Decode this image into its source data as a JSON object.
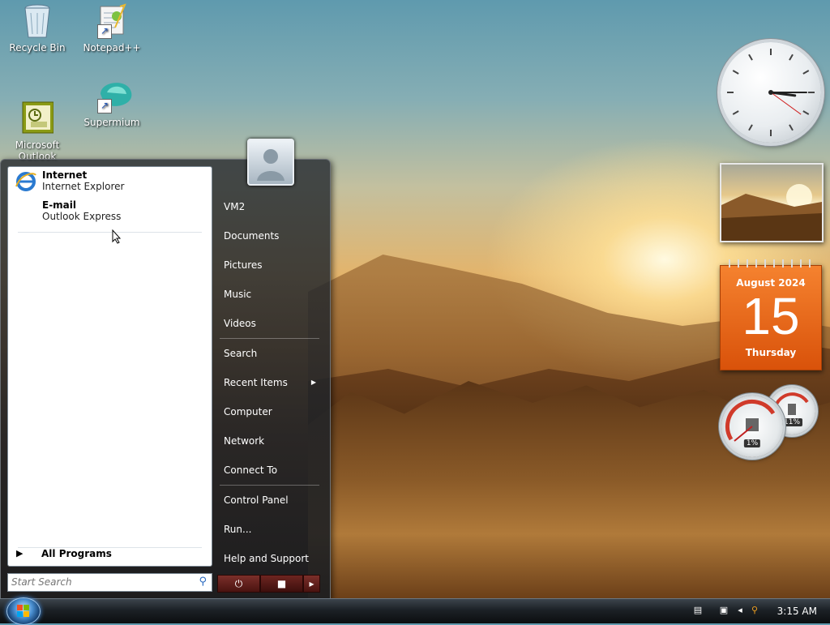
{
  "desktop": {
    "icons": [
      {
        "label": "Recycle Bin",
        "icon": "recycle-bin-icon"
      },
      {
        "label": "Notepad++",
        "icon": "notepad-plus-plus-icon"
      },
      {
        "label": "Microsoft\nOutlook",
        "icon": "outlook-icon"
      },
      {
        "label": "Supermium",
        "icon": "supermium-icon"
      }
    ]
  },
  "start_menu": {
    "pinned": [
      {
        "title": "Internet",
        "subtitle": "Internet Explorer",
        "icon": "internet-explorer-icon"
      },
      {
        "title": "E-mail",
        "subtitle": "Outlook Express",
        "icon": "outlook-express-icon"
      }
    ],
    "all_programs": "All Programs",
    "search_placeholder": "Start Search",
    "right_items": [
      "VM2",
      "Documents",
      "Pictures",
      "Music",
      "Videos",
      "Search",
      "Recent Items",
      "Computer",
      "Network",
      "Connect To",
      "Control Panel",
      "Run...",
      "Help and Support"
    ],
    "power_icons": [
      "power-icon",
      "lock-icon",
      "arrow-right-icon"
    ]
  },
  "gadgets": {
    "clock": {
      "hours": 3,
      "minutes": 15,
      "seconds": 21
    },
    "calendar": {
      "month": "August 2024",
      "day": "15",
      "weekday": "Thursday"
    },
    "cpu_meter": {
      "cpu": "1%",
      "memory": "11%"
    }
  },
  "taskbar": {
    "clock": "3:15 AM",
    "tray_icons": [
      "keyboard-icon",
      "network-icon",
      "volume-icon",
      "search-icon"
    ]
  },
  "colors": {
    "calendar_accent": "#e8681a",
    "start_orb": "#2f6fb0"
  }
}
